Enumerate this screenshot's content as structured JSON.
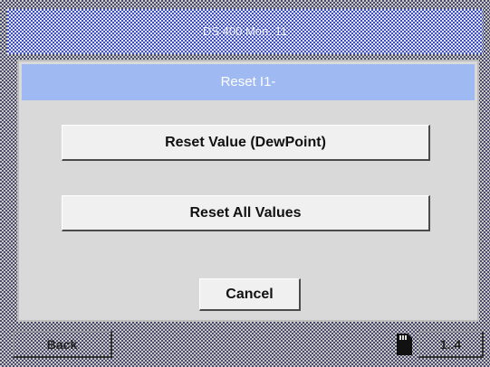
{
  "header": {
    "title": "DS 400 Mon. 11"
  },
  "dialog": {
    "title": "Reset I1-",
    "reset_value_label": "Reset Value (DewPoint)",
    "reset_all_label": "Reset All Values",
    "cancel_label": "Cancel"
  },
  "footer": {
    "back_label": "Back",
    "page_label": "1..4",
    "sd_icon": "sd-card-icon"
  },
  "colors": {
    "dialog_title_bg": "#9fb9f2",
    "dialog_bg": "#d9d9d9",
    "button_bg": "#f0f0f0"
  }
}
